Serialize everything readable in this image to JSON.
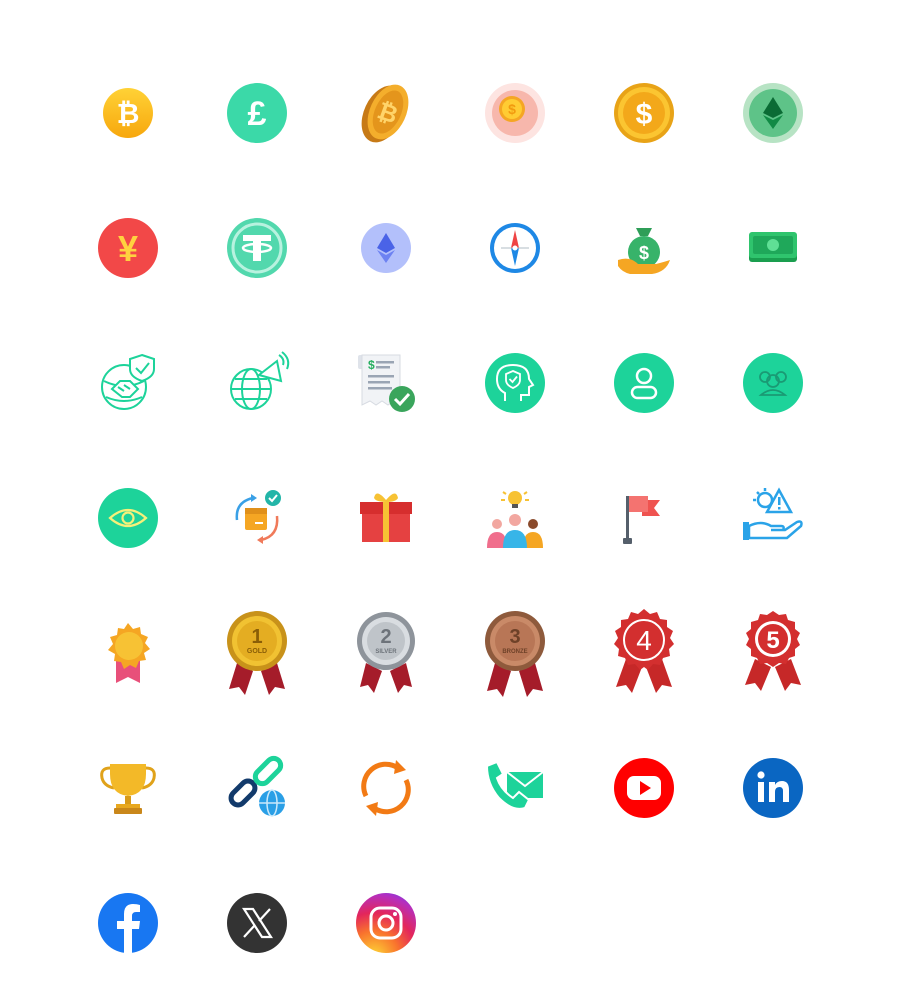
{
  "icons": [
    {
      "name": "bitcoin-coin-icon"
    },
    {
      "name": "pound-coin-icon"
    },
    {
      "name": "bitcoin-gold-coin-icon"
    },
    {
      "name": "dollar-coin-pink-icon"
    },
    {
      "name": "dollar-gold-coin-icon"
    },
    {
      "name": "ethereum-classic-icon"
    },
    {
      "name": "yen-coin-icon"
    },
    {
      "name": "tether-coin-icon"
    },
    {
      "name": "ethereum-coin-icon"
    },
    {
      "name": "compass-icon"
    },
    {
      "name": "money-bag-hand-icon"
    },
    {
      "name": "cash-stack-icon"
    },
    {
      "name": "global-partnership-icon"
    },
    {
      "name": "global-broadcast-icon"
    },
    {
      "name": "invoice-approved-icon"
    },
    {
      "name": "mind-security-icon"
    },
    {
      "name": "user-profile-icon"
    },
    {
      "name": "community-icon"
    },
    {
      "name": "eye-view-icon"
    },
    {
      "name": "delivery-cycle-icon"
    },
    {
      "name": "gift-box-icon"
    },
    {
      "name": "team-idea-icon"
    },
    {
      "name": "flag-icon"
    },
    {
      "name": "risk-management-icon"
    },
    {
      "name": "award-badge-icon"
    },
    {
      "name": "gold-medal-icon"
    },
    {
      "name": "silver-medal-icon"
    },
    {
      "name": "bronze-medal-icon"
    },
    {
      "name": "fourth-place-rosette-icon"
    },
    {
      "name": "fifth-place-rosette-icon"
    },
    {
      "name": "trophy-icon"
    },
    {
      "name": "web-link-icon"
    },
    {
      "name": "refresh-icon"
    },
    {
      "name": "phone-mail-contact-icon"
    },
    {
      "name": "youtube-icon"
    },
    {
      "name": "linkedin-icon"
    },
    {
      "name": "facebook-icon"
    },
    {
      "name": "x-twitter-icon"
    },
    {
      "name": "instagram-icon"
    }
  ],
  "medal_labels": {
    "gold_rank": "1",
    "gold_text": "GOLD",
    "silver_rank": "2",
    "silver_text": "SILVER",
    "bronze_rank": "3",
    "bronze_text": "BRONZE",
    "fourth_rank": "4",
    "fifth_rank": "5"
  },
  "colors": {
    "green": "#1dd39a",
    "gold": "#f6b91c",
    "red": "#ef4444",
    "youtube": "#ff0000",
    "linkedin": "#0a66c2",
    "facebook": "#1877f2",
    "x": "#333333"
  }
}
